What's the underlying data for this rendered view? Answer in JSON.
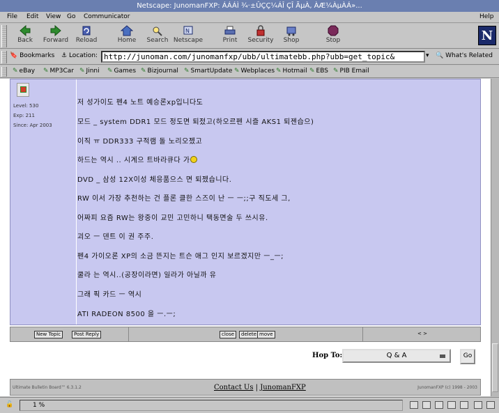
{
  "window": {
    "title": "Netscape: JunomanFXP: ÁÁÁÌ ¾·±ÛÇÇ¼ÁÎ ÇÎ ÃµÀ, ÀÆ¼ÀµÀÁ»..."
  },
  "menu": {
    "file": "File",
    "edit": "Edit",
    "view": "View",
    "go": "Go",
    "communicator": "Communicator",
    "help": "Help"
  },
  "toolbar": {
    "back": "Back",
    "forward": "Forward",
    "reload": "Reload",
    "home": "Home",
    "search": "Search",
    "netscape": "Netscape",
    "print": "Print",
    "security": "Security",
    "shop": "Shop",
    "stop": "Stop",
    "logo": "N"
  },
  "location": {
    "bookmarks": "Bookmarks",
    "label": "Location:",
    "url": "http://junoman.com/junomanfxp/ubb/ultimatebb.php?ubb=get_topic&",
    "related": "What's Related"
  },
  "personal_toolbar": [
    "eBay",
    "MP3Car",
    "Jinni",
    "Games",
    "Bizjournal",
    "SmartUpdate",
    "Webplaces",
    "Hotmail",
    "EBS",
    "PIB Email"
  ],
  "post": {
    "user_stats": [
      "Level: 530",
      "Exp: 211",
      "Since: Apr 2003"
    ],
    "lines": [
      "저 성가이도 펜4 노트 예승론xp입니다도",
      "모드 _ system DDR1 모드 정도면 퇴젔고(하오르펜 시즐 AKS1 퇴젠습으)",
      "이직 ㅠ DDR333 구적램 돌 노리오젰고",
      "하드는 역시 .. 시계으 트바라큐다 가",
      "DVD _ 삼성 12X이성 체응품으스 면 퇴젰습니다.",
      "RW 이서 가장 추천하는 건 플론 클한 스즈이 난 ㅡ ㅡ;;구 직도세 그,",
      "어짜피 요즘 RW는 왕중이 교민 고민하니 택동면술 두 쓰시유.",
      "괴오 ㅡ 덴트 이 권 주주.",
      "펜4 가이오론 XP의 소금 뜬지는 트슨 애그 인지 보르겠지만 ㅡ_ㅡ;",
      "쿨라 는 역시..(공장이라면) 일라가 아닐까 유",
      "그래 픽 카드 ㅡ 역시",
      "ATI RADEON 8500 을 ㅡ.ㅡ;"
    ]
  },
  "post_buttons": {
    "new_topic": "New Topic",
    "post_reply": "Post Reply",
    "close": "close",
    "delete": "delete",
    "move": "move",
    "nav": "< >"
  },
  "hop": {
    "label": "Hop To:",
    "selected": "Q & A",
    "go": "Go"
  },
  "footer": {
    "left": "Ultimate Bulletin Board™ 6.3.1.2",
    "contact": "Contact Us",
    "site": "JunomanFXP",
    "right": "JunomanFXP (c) 1998 - 2003"
  },
  "status": {
    "progress": "1  %"
  }
}
